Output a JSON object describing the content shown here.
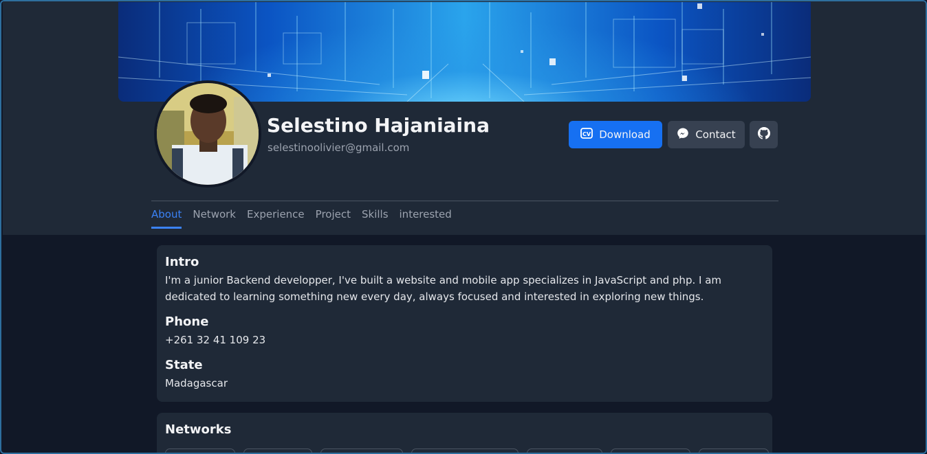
{
  "profile": {
    "name": "Selestino Hajaniaina",
    "email": "selestinoolivier@gmail.com"
  },
  "actions": {
    "download_label": "Download",
    "contact_label": "Contact",
    "download_icon": "cv-icon",
    "contact_icon": "messenger-icon",
    "github_icon": "github-icon"
  },
  "tabs": [
    {
      "label": "About",
      "active": true
    },
    {
      "label": "Network",
      "active": false
    },
    {
      "label": "Experience",
      "active": false
    },
    {
      "label": "Project",
      "active": false
    },
    {
      "label": "Skills",
      "active": false
    },
    {
      "label": "interested",
      "active": false
    }
  ],
  "about": {
    "intro_title": "Intro",
    "intro_text": "I'm a junior Backend developper, I've built a website and mobile app specializes in JavaScript and php. I am dedicated to learning something new every day, always focused and interested in exploring new things.",
    "phone_title": "Phone",
    "phone": "+261 32 41 109 23",
    "state_title": "State",
    "state": "Madagascar"
  },
  "networks": {
    "title": "Networks"
  },
  "colors": {
    "accent": "#1670f2",
    "page_bg": "#111827",
    "card_bg": "#1f2937",
    "active_tab": "#3b82f6"
  }
}
